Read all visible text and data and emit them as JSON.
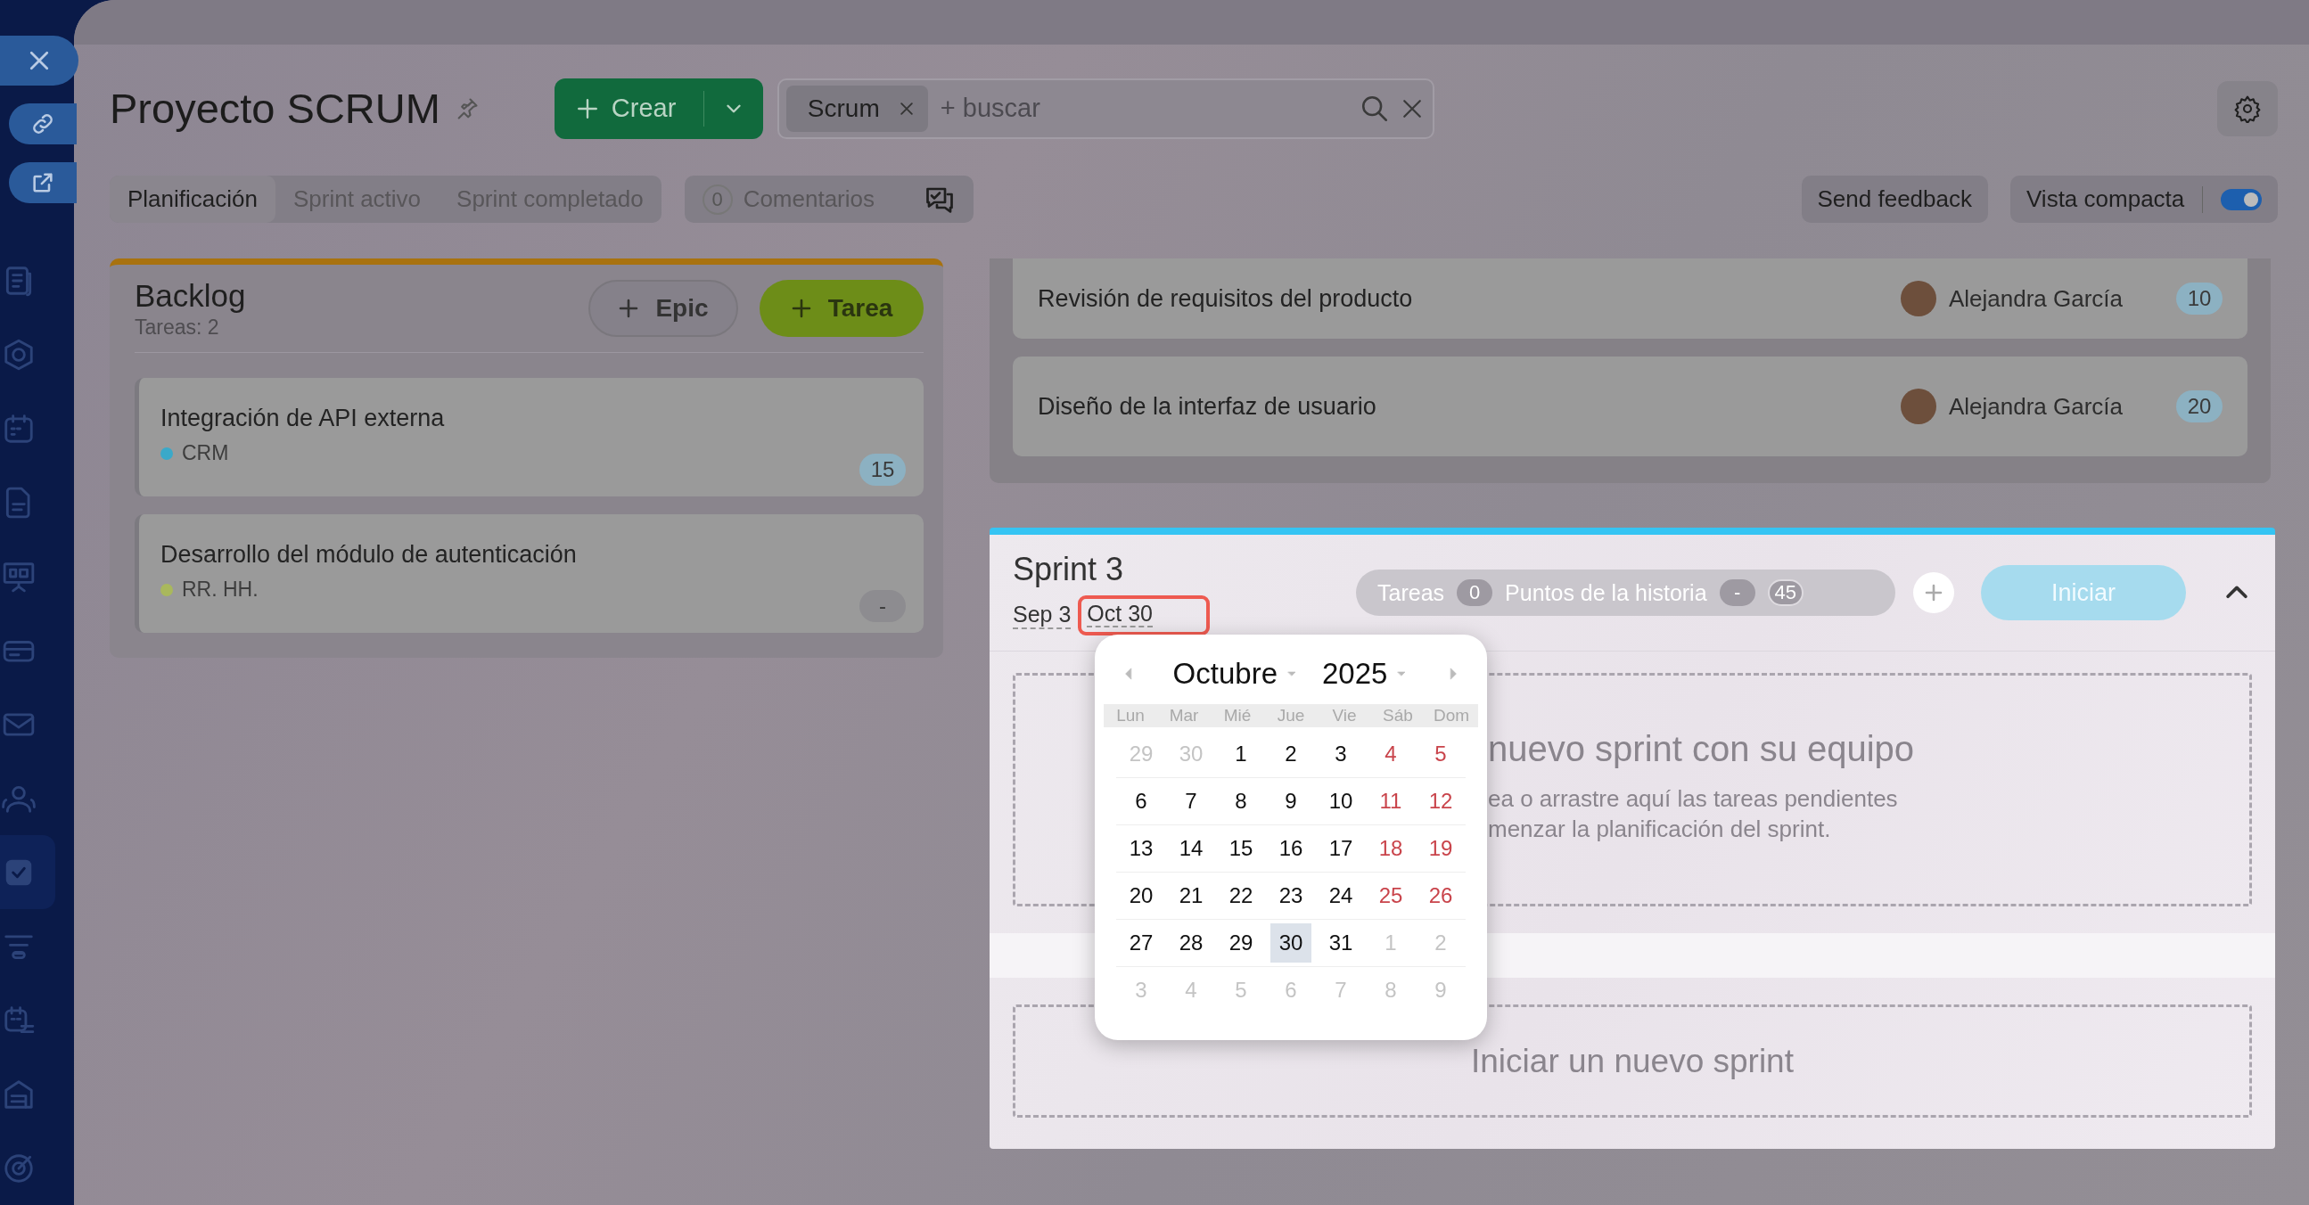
{
  "sidebar": {
    "items": [
      {
        "selected": false
      },
      {
        "selected": false
      },
      {
        "selected": false
      },
      {
        "selected": false
      },
      {
        "selected": false
      },
      {
        "selected": false
      },
      {
        "selected": false
      },
      {
        "selected": false
      },
      {
        "selected": true
      },
      {
        "selected": false
      },
      {
        "selected": false
      },
      {
        "selected": false
      },
      {
        "selected": false
      }
    ]
  },
  "header": {
    "title": "Proyecto SCRUM",
    "create_button": "Crear",
    "filter_chip": "Scrum",
    "search": {
      "placeholder": "+ buscar"
    }
  },
  "tabs": [
    {
      "label": "Planificación",
      "selected": true
    },
    {
      "label": "Sprint activo",
      "selected": false
    },
    {
      "label": "Sprint completado",
      "selected": false
    }
  ],
  "comments": {
    "count": "0",
    "label": "Comentarios"
  },
  "feedback_button": "Send feedback",
  "compact_view": {
    "label": "Vista compacta",
    "on": true
  },
  "backlog": {
    "title": "Backlog",
    "subtitle": "Tareas: 2",
    "buttons": [
      "Epic",
      "Tarea"
    ],
    "tasks": [
      {
        "title": "Integración de API externa",
        "tag": "CRM",
        "color": "#3aa9c9",
        "points": "15",
        "estimated": true
      },
      {
        "title": "Desarrollo del módulo de autenticación",
        "tag": "RR. HH.",
        "color": "#a9b85c",
        "points": "-",
        "estimated": false
      }
    ]
  },
  "sprint_tasks": [
    {
      "title": "Revisión de requisitos del producto",
      "assignee": "Alejandra García",
      "points": "10"
    },
    {
      "title": "Diseño de la interfaz de usuario",
      "assignee": "Alejandra García",
      "points": "20"
    }
  ],
  "sprint": {
    "title": "Sprint 3",
    "start_date": "Sep 3",
    "end_date": "Oct 30",
    "expanded": true,
    "stats": [
      {
        "label": "Tareas",
        "value": "0"
      },
      {
        "label": "Puntos de la historia",
        "value": "-"
      },
      {
        "value": "45"
      }
    ],
    "start_button": "Iniciar",
    "dropzone": {
      "title": "nuevo sprint con su equipo",
      "lines": [
        "ea o arrastre aquí las tareas pendientes",
        "menzar la planificación del sprint."
      ]
    },
    "new_sprint": "Iniciar un nuevo sprint"
  },
  "calendar": {
    "month": "Octubre",
    "year": "2025",
    "weekdays": [
      "Lun",
      "Mar",
      "Mié",
      "Jue",
      "Vie",
      "Sáb",
      "Dom"
    ],
    "weeks": [
      [
        {
          "day": "29",
          "kind": "outside",
          "selected": false
        },
        {
          "day": "30",
          "kind": "outside",
          "selected": false
        },
        {
          "day": "1",
          "kind": "weekday",
          "selected": false
        },
        {
          "day": "2",
          "kind": "weekday",
          "selected": false
        },
        {
          "day": "3",
          "kind": "weekday",
          "selected": false
        },
        {
          "day": "4",
          "kind": "weekend",
          "selected": false
        },
        {
          "day": "5",
          "kind": "weekend",
          "selected": false
        }
      ],
      [
        {
          "day": "6",
          "kind": "weekday",
          "selected": false
        },
        {
          "day": "7",
          "kind": "weekday",
          "selected": false
        },
        {
          "day": "8",
          "kind": "weekday",
          "selected": false
        },
        {
          "day": "9",
          "kind": "weekday",
          "selected": false
        },
        {
          "day": "10",
          "kind": "weekday",
          "selected": false
        },
        {
          "day": "11",
          "kind": "weekend",
          "selected": false
        },
        {
          "day": "12",
          "kind": "weekend",
          "selected": false
        }
      ],
      [
        {
          "day": "13",
          "kind": "weekday",
          "selected": false
        },
        {
          "day": "14",
          "kind": "weekday",
          "selected": false
        },
        {
          "day": "15",
          "kind": "weekday",
          "selected": false
        },
        {
          "day": "16",
          "kind": "weekday",
          "selected": false
        },
        {
          "day": "17",
          "kind": "weekday",
          "selected": false
        },
        {
          "day": "18",
          "kind": "weekend",
          "selected": false
        },
        {
          "day": "19",
          "kind": "weekend",
          "selected": false
        }
      ],
      [
        {
          "day": "20",
          "kind": "weekday",
          "selected": false
        },
        {
          "day": "21",
          "kind": "weekday",
          "selected": false
        },
        {
          "day": "22",
          "kind": "weekday",
          "selected": false
        },
        {
          "day": "23",
          "kind": "weekday",
          "selected": false
        },
        {
          "day": "24",
          "kind": "weekday",
          "selected": false
        },
        {
          "day": "25",
          "kind": "weekend",
          "selected": false
        },
        {
          "day": "26",
          "kind": "weekend",
          "selected": false
        }
      ],
      [
        {
          "day": "27",
          "kind": "weekday",
          "selected": false
        },
        {
          "day": "28",
          "kind": "weekday",
          "selected": false
        },
        {
          "day": "29",
          "kind": "weekday",
          "selected": false
        },
        {
          "day": "30",
          "kind": "weekday",
          "selected": true
        },
        {
          "day": "31",
          "kind": "weekday",
          "selected": false
        },
        {
          "day": "1",
          "kind": "outside",
          "selected": false
        },
        {
          "day": "2",
          "kind": "outside",
          "selected": false
        }
      ],
      [
        {
          "day": "3",
          "kind": "outside",
          "selected": false
        },
        {
          "day": "4",
          "kind": "outside",
          "selected": false
        },
        {
          "day": "5",
          "kind": "outside",
          "selected": false
        },
        {
          "day": "6",
          "kind": "outside",
          "selected": false
        },
        {
          "day": "7",
          "kind": "outside",
          "selected": false
        },
        {
          "day": "8",
          "kind": "outside",
          "selected": false
        },
        {
          "day": "9",
          "kind": "outside",
          "selected": false
        }
      ]
    ]
  }
}
